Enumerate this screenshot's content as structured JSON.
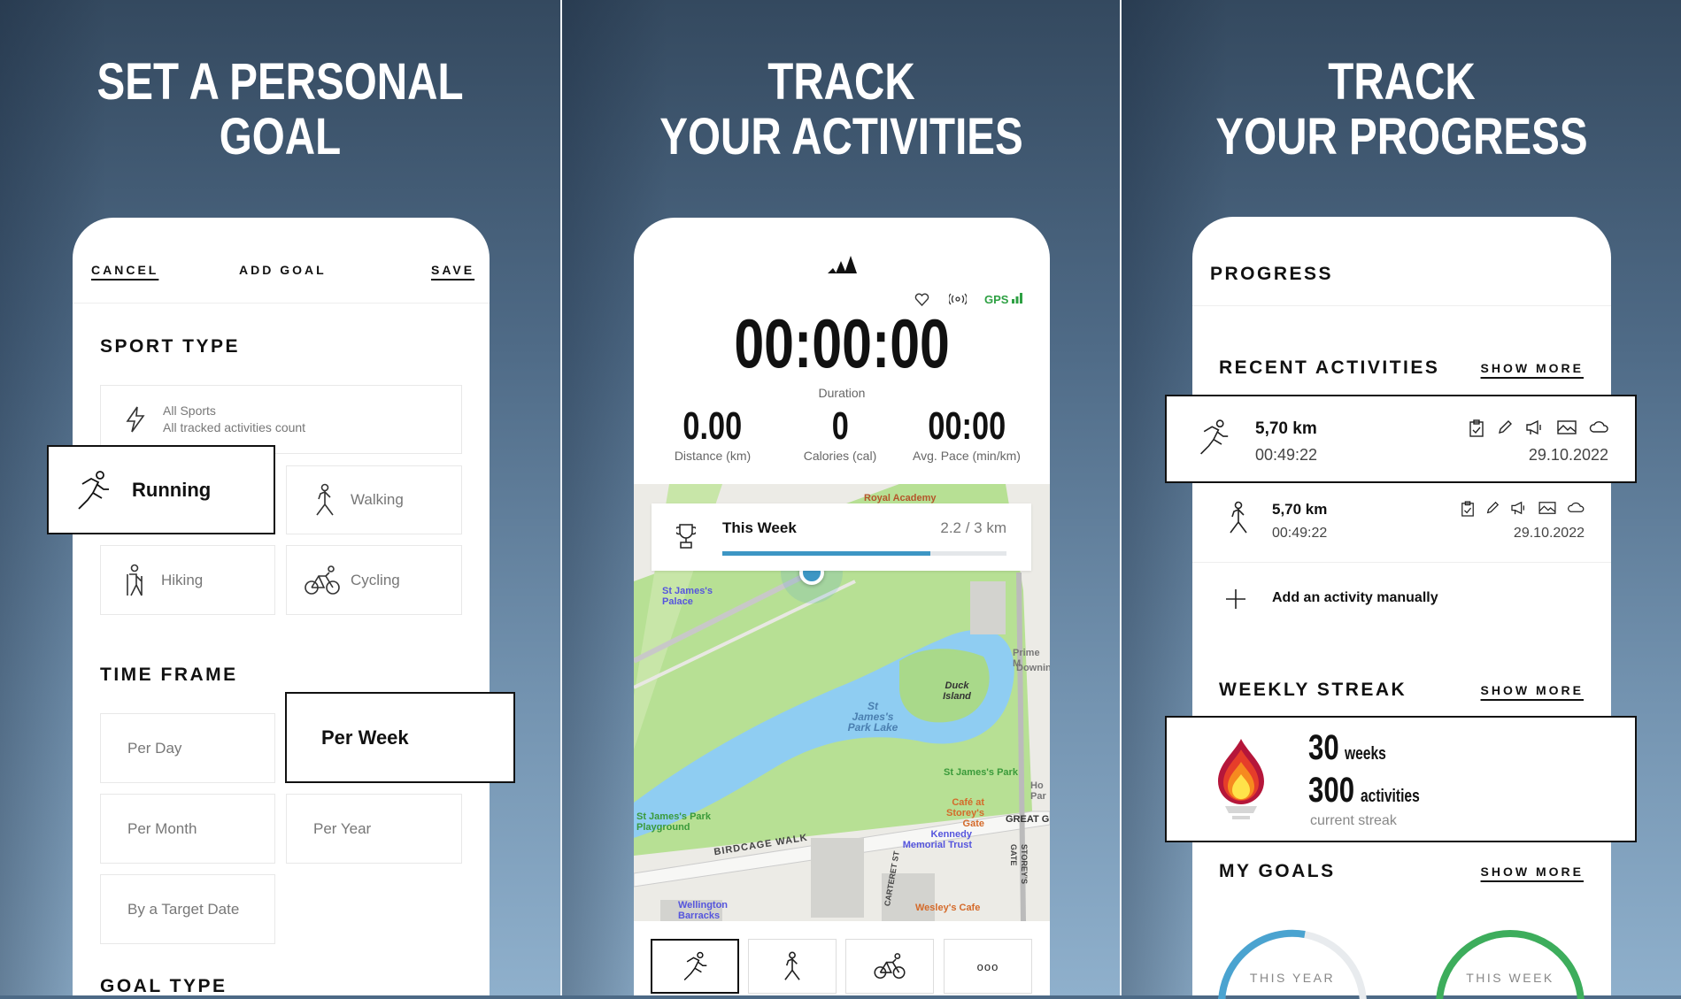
{
  "colors": {
    "accent_blue": "#3d96c4",
    "gps_green": "#2ea043",
    "ring_blue": "#4aa3d0",
    "ring_green": "#3dad5c",
    "map_green": "#b7e094",
    "lake_blue": "#8fcdf2"
  },
  "panels": [
    {
      "headline": [
        "SET A PERSONAL",
        "GOAL"
      ]
    },
    {
      "headline": [
        "TRACK",
        "YOUR ACTIVITIES"
      ]
    },
    {
      "headline": [
        "TRACK",
        "YOUR PROGRESS"
      ]
    }
  ],
  "goal": {
    "cancel": "CANCEL",
    "title": "ADD GOAL",
    "save": "SAVE",
    "sport_type": "SPORT TYPE",
    "all_sports": {
      "label": "All Sports",
      "sub": "All tracked activities count",
      "icon": "lightning-icon"
    },
    "sports": [
      {
        "label": "Running",
        "icon": "running-icon",
        "selected": true
      },
      {
        "label": "Walking",
        "icon": "walking-icon"
      },
      {
        "label": "Hiking",
        "icon": "hiking-icon"
      },
      {
        "label": "Cycling",
        "icon": "cycling-icon"
      }
    ],
    "time_frame": "TIME FRAME",
    "frames": [
      {
        "label": "Per Day"
      },
      {
        "label": "Per Week",
        "selected": true
      },
      {
        "label": "Per Month"
      },
      {
        "label": "Per Year"
      },
      {
        "label": "By a Target Date"
      }
    ],
    "goal_type": "GOAL TYPE"
  },
  "tracker": {
    "logo": "adidas-logo",
    "gps": "GPS",
    "duration": "00:00:00",
    "duration_label": "Duration",
    "stats": [
      {
        "value": "0.00",
        "label": "Distance (km)"
      },
      {
        "value": "0",
        "label": "Calories (cal)"
      },
      {
        "value": "00:00",
        "label": "Avg. Pace (min/km)"
      }
    ],
    "week_card": {
      "title": "This Week",
      "value": "2.2 / 3 km",
      "progress": 0.733
    },
    "map_labels": [
      "Royal Academy",
      "St James's Palace",
      "St James's Park Lake",
      "Duck Island",
      "Prime M",
      "Downin",
      "St James's Park",
      "Ho Par",
      "Café at Storey's Gate",
      "GREAT G",
      "St James's Park Playground",
      "Kennedy Memorial Trust",
      "BIRDCAGE WALK",
      "CARTERET ST",
      "STOREY'S GATE",
      "Wellington Barracks",
      "Wesley's Cafe"
    ],
    "tabs": [
      {
        "icon": "running-icon",
        "selected": true
      },
      {
        "icon": "walking-icon"
      },
      {
        "icon": "cycling-icon"
      },
      {
        "icon": "more-icon",
        "label": "ooo"
      }
    ]
  },
  "progress": {
    "title": "PROGRESS",
    "recent": "RECENT ACTIVITIES",
    "show_more": "SHOW MORE",
    "activities": [
      {
        "distance": "5,70 km",
        "time": "00:49:22",
        "date": "29.10.2022",
        "icon": "running-icon"
      },
      {
        "distance": "5,70 km",
        "time": "00:49:22",
        "date": "29.10.2022",
        "icon": "walking-icon"
      }
    ],
    "add_manual": "Add an activity manually",
    "streak_title": "WEEKLY STREAK",
    "streak": {
      "weeks": "30",
      "weeks_unit": "weeks",
      "activities": "300",
      "activities_unit": "activities",
      "sub": "current streak"
    },
    "goals_title": "MY GOALS",
    "goals": [
      {
        "label": "THIS YEAR"
      },
      {
        "label": "THIS WEEK"
      }
    ]
  }
}
